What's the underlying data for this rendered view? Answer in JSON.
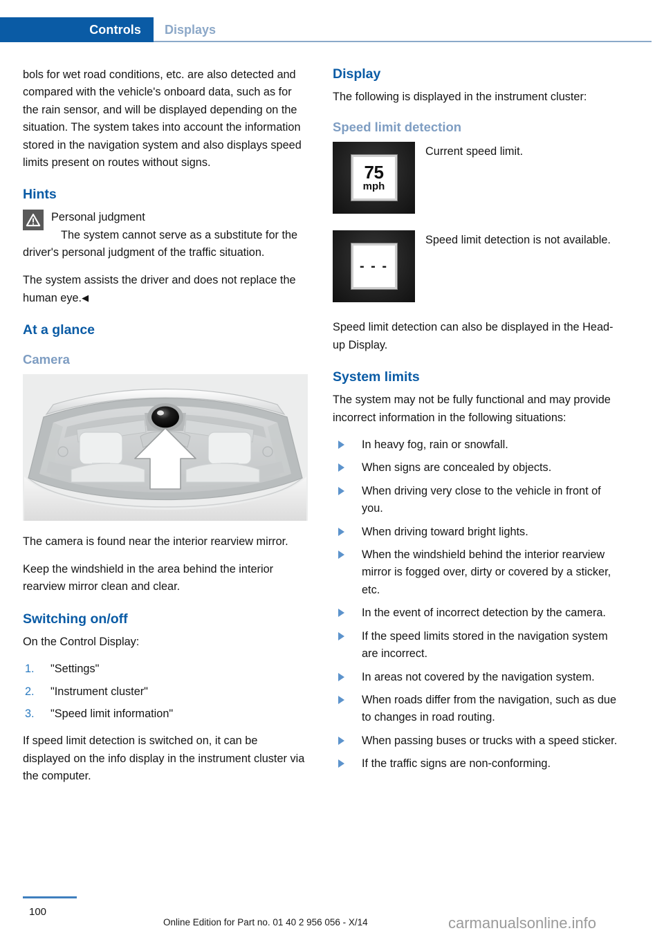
{
  "header": {
    "active_tab": "Controls",
    "inactive_tab": "Displays",
    "accent_color": "#0a5ba5",
    "inactive_color": "#8ca8c8"
  },
  "left_column": {
    "intro_paragraph": "bols for wet road conditions, etc. are also detected and compared with the vehicle's onboard data, such as for the rain sensor, and will be displayed depending on the situation. The system takes into account the information stored in the navigation system and also displays speed limits present on routes without signs.",
    "hints_heading": "Hints",
    "note": {
      "icon": "warning-triangle-icon",
      "title": "Personal judgment",
      "body": "The system cannot serve as a substitute for the driver's personal judgment of the traffic situation."
    },
    "assist_paragraph": "The system assists the driver and does not replace the human eye.",
    "end_mark": "◀",
    "at_a_glance_heading": "At a glance",
    "camera_subheading": "Camera",
    "camera_figure_alt": "car-interior-windshield-camera-illustration",
    "camera_paragraph_1": "The camera is found near the interior rearview mirror.",
    "camera_paragraph_2": "Keep the windshield in the area behind the interior rearview mirror clean and clear.",
    "switching_heading": "Switching on/off",
    "switching_intro": "On the Control Display:",
    "steps": [
      {
        "number": "1.",
        "label": "\"Settings\""
      },
      {
        "number": "2.",
        "label": "\"Instrument cluster\""
      },
      {
        "number": "3.",
        "label": "\"Speed limit information\""
      }
    ],
    "switching_outro": "If speed limit detection is switched on, it can be displayed on the info display in the instrument cluster via the computer."
  },
  "right_column": {
    "display_heading": "Display",
    "display_intro": "The following is displayed in the instrument cluster:",
    "speed_limit_subheading": "Speed limit detection",
    "icon_rows": [
      {
        "icon_name": "speed-limit-sign-75mph-icon",
        "sign_value": "75",
        "sign_unit": "mph",
        "caption": "Current speed limit."
      },
      {
        "icon_name": "speed-limit-unavailable-icon",
        "sign_value": "- - -",
        "sign_unit": "",
        "caption": "Speed limit detection is not available."
      }
    ],
    "hud_paragraph": "Speed limit detection can also be displayed in the Head-up Display.",
    "system_limits_heading": "System limits",
    "system_limits_intro": "The system may not be fully functional and may provide incorrect information in the following situations:",
    "bullets": [
      "In heavy fog, rain or snowfall.",
      "When signs are concealed by objects.",
      "When driving very close to the vehicle in front of you.",
      "When driving toward bright lights.",
      "When the windshield behind the interior rearview mirror is fogged over, dirty or covered by a sticker, etc.",
      "In the event of incorrect detection by the camera.",
      "If the speed limits stored in the navigation system are incorrect.",
      "In areas not covered by the navigation system.",
      "When roads differ from the navigation, such as due to changes in road routing.",
      "When passing buses or trucks with a speed sticker.",
      "If the traffic signs are non-conforming."
    ]
  },
  "footer": {
    "page_number": "100",
    "edition_note": "Online Edition for Part no. 01 40 2 956 056 - X/14",
    "watermark": "carmanualsonline.info"
  }
}
